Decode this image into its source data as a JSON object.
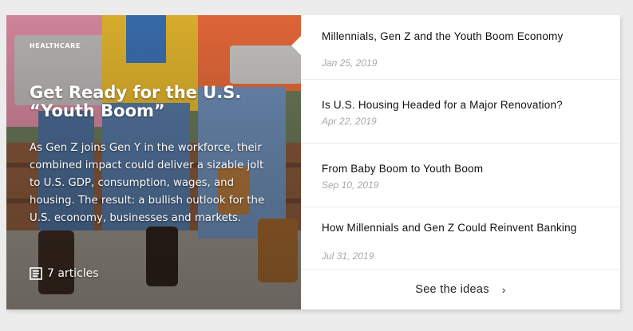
{
  "hero": {
    "tag": "HEALTHCARE",
    "title": "Get Ready for the U.S. “Youth Boom”",
    "description": "As Gen Z joins Gen Y in the workforce, their combined impact could deliver a sizable jolt to U.S. GDP, consumption, wages, and housing. The result: a bullish outlook for the U.S. economy, businesses and markets.",
    "article_count": "7 articles",
    "icon": "document-icon"
  },
  "articles": [
    {
      "title": "Millennials, Gen Z and the Youth Boom Economy",
      "date": "Jan 25, 2019"
    },
    {
      "title": "Is U.S. Housing Headed for a Major Renovation?",
      "date": "Apr 22, 2019"
    },
    {
      "title": "From Baby Boom to Youth Boom",
      "date": "Sep 10, 2019"
    },
    {
      "title": "How Millennials and Gen Z Could Reinvent Banking",
      "date": "Jul 31, 2019"
    }
  ],
  "footer": {
    "see_ideas": "See the ideas",
    "icon": "chevron-right-icon"
  },
  "colors": {
    "background": "#ececec",
    "card": "#ffffff",
    "title_text": "#111111",
    "date_text": "#a8a8a8"
  }
}
